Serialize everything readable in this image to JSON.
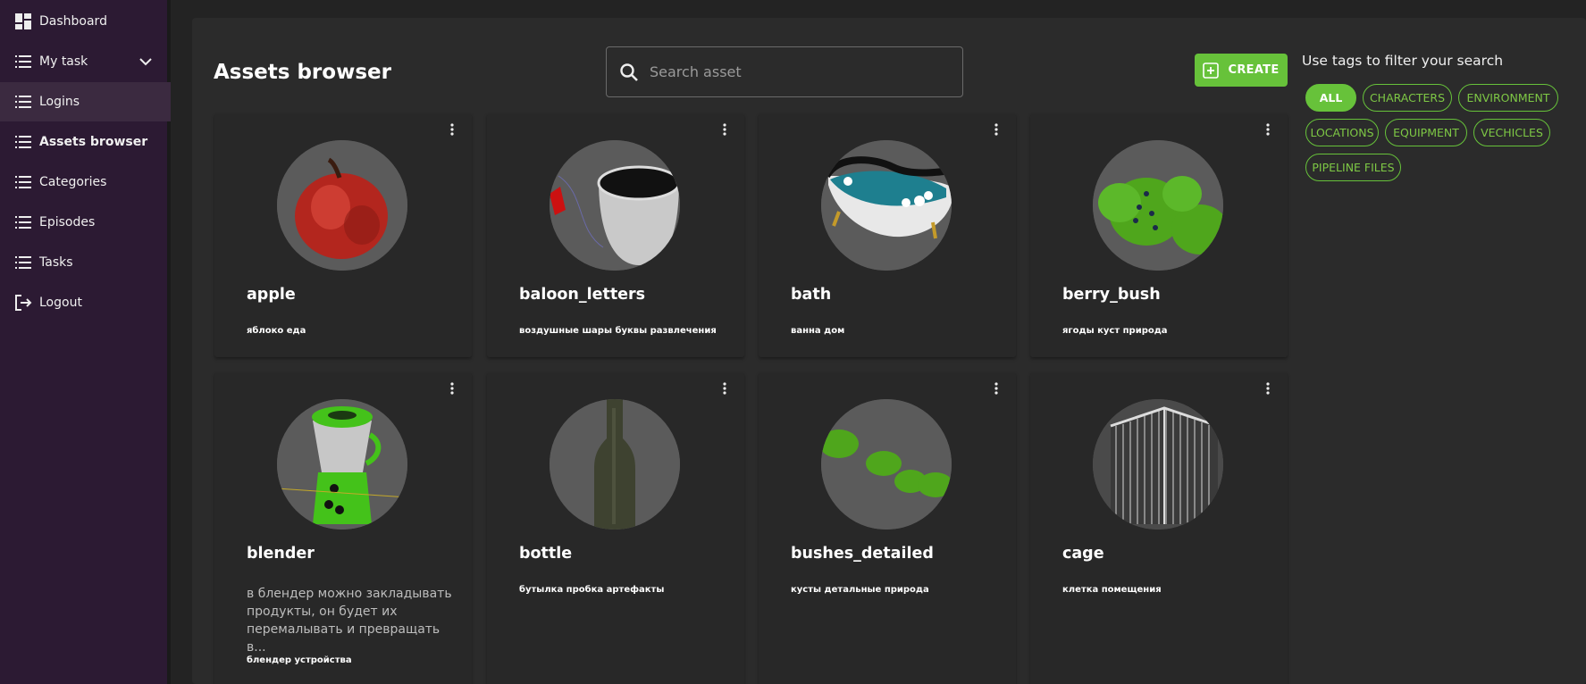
{
  "sidebar": {
    "items": [
      {
        "label": "Dashboard",
        "icon": "dashboard-icon"
      },
      {
        "label": "My task",
        "icon": "list-icon"
      },
      {
        "label": "Logins",
        "icon": "list-icon"
      },
      {
        "label": "Assets browser",
        "icon": "list-icon"
      },
      {
        "label": "Categories",
        "icon": "list-icon"
      },
      {
        "label": "Episodes",
        "icon": "list-icon"
      },
      {
        "label": "Tasks",
        "icon": "list-icon"
      },
      {
        "label": "Logout",
        "icon": "logout-icon"
      }
    ],
    "active": "Assets browser",
    "hovered": "Logins"
  },
  "header": {
    "title": "Assets browser",
    "search_placeholder": "Search asset",
    "create_label": "CREATE"
  },
  "filters": {
    "hint": "Use tags to filter your search",
    "tags": [
      "ALL",
      "CHARACTERS",
      "ENVIRONMENT",
      "LOCATIONS",
      "EQUIPMENT",
      "VECHICLES",
      "PIPELINE FILES"
    ],
    "active": "ALL"
  },
  "assets": [
    {
      "name": "apple",
      "description": "",
      "tags": "яблоко еда",
      "icon": "apple-thumbnail"
    },
    {
      "name": "baloon_letters",
      "description": "",
      "tags": "воздушные шары буквы развлечения",
      "icon": "balloon-thumbnail"
    },
    {
      "name": "bath",
      "description": "",
      "tags": "ванна дом",
      "icon": "bath-thumbnail"
    },
    {
      "name": "berry_bush",
      "description": "",
      "tags": "ягоды куст природа",
      "icon": "bush-thumbnail"
    },
    {
      "name": "blender",
      "description": "в блендер можно закладывать продукты, он будет их перемалывать и превращать в...",
      "tags": "блендер устройства",
      "icon": "blender-thumbnail"
    },
    {
      "name": "bottle",
      "description": "",
      "tags": "бутылка пробка артефакты",
      "icon": "bottle-thumbnail"
    },
    {
      "name": "bushes_detailed",
      "description": "",
      "tags": "кусты детальные природа",
      "icon": "bushes-thumbnail"
    },
    {
      "name": "cage",
      "description": "",
      "tags": "клетка помещения",
      "icon": "cage-thumbnail"
    }
  ],
  "colors": {
    "accent": "#67c23a",
    "sidebar": "#2c1a33",
    "panel": "#2b2b2b"
  }
}
